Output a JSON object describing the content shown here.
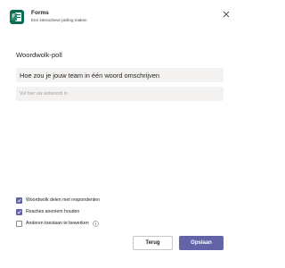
{
  "header": {
    "app_name": "Forms",
    "subtitle": "Een interactieve peiling maken",
    "logo_icon": "forms-logo-icon",
    "close_icon": "close-icon"
  },
  "poll": {
    "title": "Woordwolk-poll",
    "question": "Hoe zou je jouw team in één woord omschrijven",
    "answer_placeholder": "Vul hier uw antwoord in",
    "answer_value": ""
  },
  "options": [
    {
      "label": "Woordwolk delen met respondenten",
      "checked": true
    },
    {
      "label": "Reacties anoniem houden",
      "checked": true
    },
    {
      "label": "Anderen toestaan te bewerken",
      "checked": false,
      "info_icon": "info-icon"
    }
  ],
  "buttons": {
    "back_label": "Terug",
    "save_label": "Opslaan"
  },
  "colors": {
    "accent": "#6264a7",
    "brand": "#0b6a53",
    "field_background": "#f3f2f1"
  }
}
